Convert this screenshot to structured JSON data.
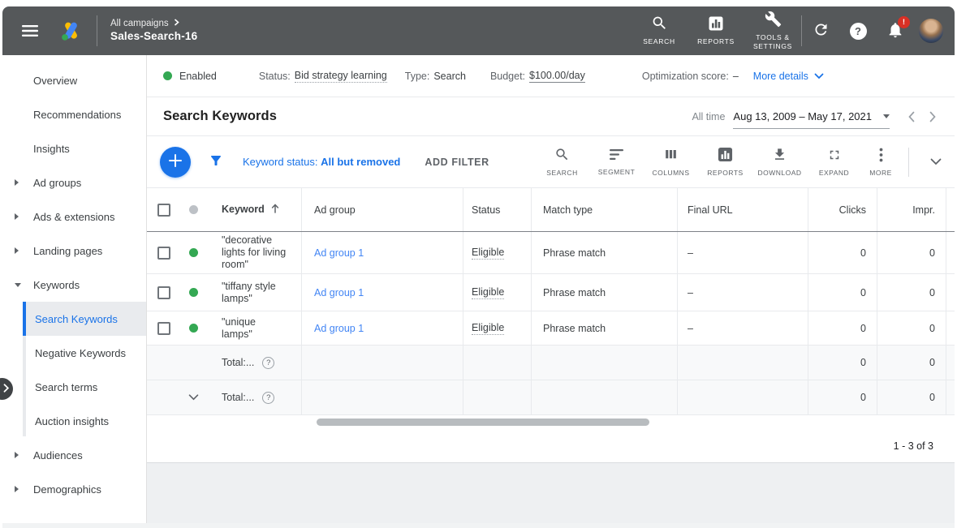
{
  "topbar": {
    "breadcrumb_root": "All campaigns",
    "campaign_name": "Sales-Search-16",
    "nav": {
      "search": "SEARCH",
      "reports": "REPORTS",
      "tools": "TOOLS &\nSETTINGS"
    },
    "help_glyph": "?",
    "notification_badge": "!"
  },
  "sidebar": {
    "items": [
      {
        "label": "Overview"
      },
      {
        "label": "Recommendations"
      },
      {
        "label": "Insights"
      },
      {
        "label": "Ad groups"
      },
      {
        "label": "Ads & extensions"
      },
      {
        "label": "Landing pages"
      },
      {
        "label": "Keywords"
      },
      {
        "label": "Search Keywords"
      },
      {
        "label": "Negative Keywords"
      },
      {
        "label": "Search terms"
      },
      {
        "label": "Auction insights"
      },
      {
        "label": "Audiences"
      },
      {
        "label": "Demographics"
      }
    ]
  },
  "status_bar": {
    "enabled_label": "Enabled",
    "status_label": "Status:",
    "status_value": "Bid strategy learning",
    "type_label": "Type:",
    "type_value": "Search",
    "budget_label": "Budget:",
    "budget_value": "$100.00/day",
    "optimization_label": "Optimization score:",
    "optimization_value": "–",
    "more_details": "More details"
  },
  "title_row": {
    "title": "Search Keywords",
    "date_range_label": "All time",
    "date_range": "Aug 13, 2009 – May 17, 2021"
  },
  "toolbar": {
    "filter_chip_label": "Keyword status:",
    "filter_chip_value": "All but removed",
    "add_filter": "ADD FILTER",
    "icons": {
      "search": "SEARCH",
      "segment": "SEGMENT",
      "columns": "COLUMNS",
      "reports": "REPORTS",
      "download": "DOWNLOAD",
      "expand": "EXPAND",
      "more": "MORE"
    }
  },
  "table": {
    "help_glyph": "?",
    "headers": {
      "keyword": "Keyword",
      "ad_group": "Ad group",
      "status": "Status",
      "match_type": "Match type",
      "final_url": "Final URL",
      "clicks": "Clicks",
      "impr": "Impr."
    },
    "rows": [
      {
        "keyword": "\"decorative\nlights for living\nroom\"",
        "ad_group": "Ad group 1",
        "status": "Eligible",
        "match_type": "Phrase match",
        "final_url": "–",
        "clicks": "0",
        "impr": "0"
      },
      {
        "keyword": "\"tiffany style\nlamps\"",
        "ad_group": "Ad group 1",
        "status": "Eligible",
        "match_type": "Phrase match",
        "final_url": "–",
        "clicks": "0",
        "impr": "0"
      },
      {
        "keyword": "\"unique\nlamps\"",
        "ad_group": "Ad group 1",
        "status": "Eligible",
        "match_type": "Phrase match",
        "final_url": "–",
        "clicks": "0",
        "impr": "0"
      }
    ],
    "totals": [
      {
        "label": "Total:...",
        "clicks": "0",
        "impr": "0"
      },
      {
        "label": "Total:...",
        "clicks": "0",
        "impr": "0"
      }
    ]
  },
  "pagination": "1 - 3 of 3",
  "colors": {
    "topbar": "#55585a",
    "accent_blue": "#1a73e8",
    "link_blue": "#4285f4",
    "green": "#34a853",
    "badge_red": "#d93025",
    "totals_bg": "#f8f9fa"
  }
}
